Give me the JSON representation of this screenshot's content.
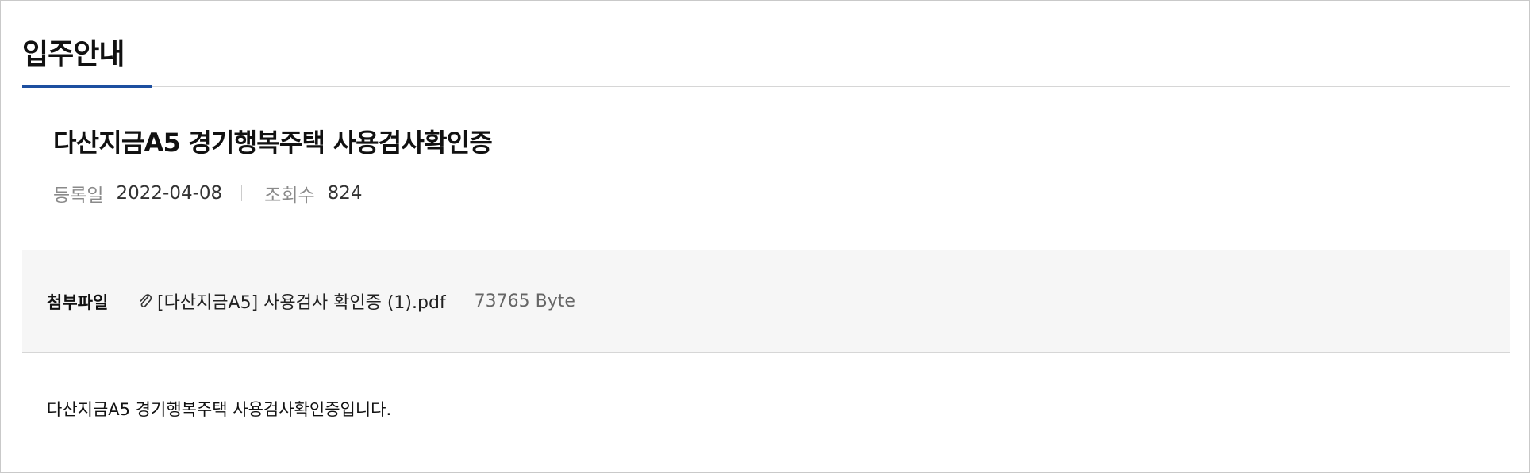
{
  "section": {
    "title": "입주안내"
  },
  "post": {
    "title": "다산지금A5 경기행복주택 사용검사확인증",
    "meta": {
      "date_label": "등록일",
      "date_value": "2022-04-08",
      "views_label": "조회수",
      "views_value": "824"
    }
  },
  "attachments": {
    "label": "첨부파일",
    "files": [
      {
        "icon": "paperclip-icon",
        "name": "[다산지금A5] 사용검사 확인증 (1).pdf",
        "size": "73765 Byte"
      }
    ]
  },
  "content": {
    "body": "다산지금A5 경기행복주택 사용검사확인증입니다."
  },
  "colors": {
    "accent": "#1d4fa0",
    "attachment_background": "#f6f6f6",
    "border": "#d6d6d6",
    "meta_label": "#8a8a8a"
  }
}
